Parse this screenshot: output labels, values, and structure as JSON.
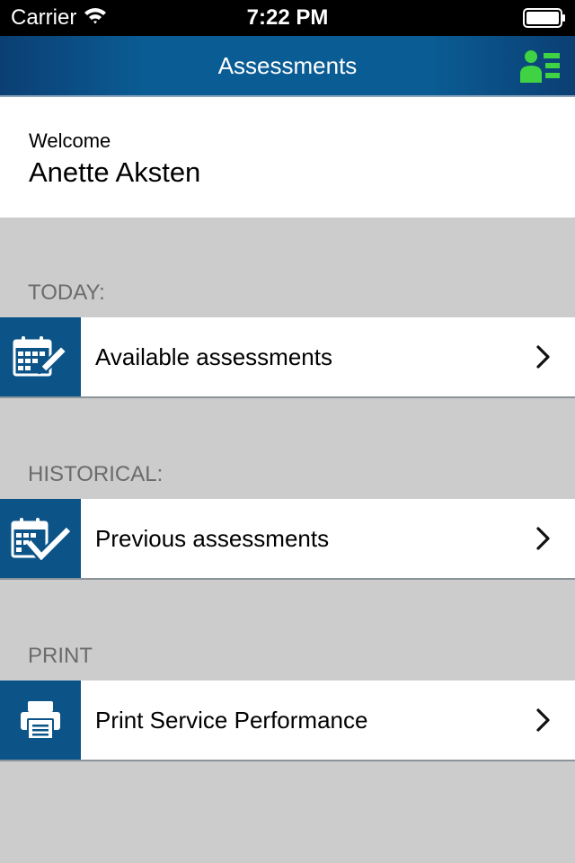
{
  "status_bar": {
    "carrier": "Carrier",
    "time": "7:22 PM"
  },
  "nav": {
    "title": "Assessments",
    "profile_icon": "profile-list-icon",
    "profile_icon_color": "#3fd243"
  },
  "welcome": {
    "label": "Welcome",
    "name": "Anette Aksten"
  },
  "sections": [
    {
      "header": "TODAY:",
      "item": {
        "label": "Available assessments",
        "icon": "calendar-edit-icon"
      }
    },
    {
      "header": "HISTORICAL:",
      "item": {
        "label": "Previous assessments",
        "icon": "calendar-check-icon"
      }
    },
    {
      "header": "PRINT",
      "item": {
        "label": "Print Service Performance",
        "icon": "printer-icon"
      }
    }
  ],
  "colors": {
    "nav_blue": "#0a5c94",
    "icon_tile_blue": "#0c5488",
    "background_gray": "#cccccc",
    "section_text_gray": "#6b6b6b"
  }
}
